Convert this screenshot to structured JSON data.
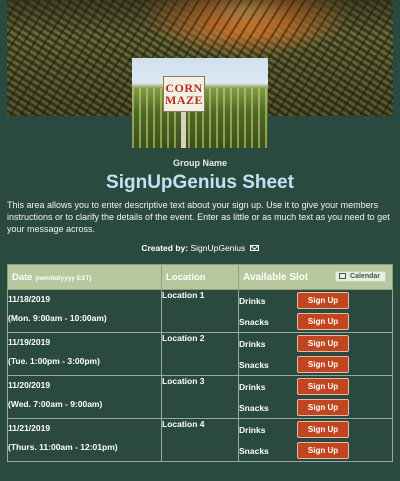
{
  "header": {
    "group_name": "Group Name",
    "title": "SignUpGenius Sheet",
    "description": "This area allows you to enter descriptive text about your sign up. Use it to give your members instructions or to clarify the details of the event. Enter as little or as much text as you need to get your message across.",
    "created_by_label": "Created by:",
    "created_by_name": "SignUpGenius",
    "photo_sign_line1": "CORN",
    "photo_sign_line2": "MAZE"
  },
  "table": {
    "col_date": "Date",
    "col_date_hint": "(mm/dd/yyyy EST)",
    "col_location": "Location",
    "col_slot": "Available Slot",
    "calendar_label": "Calendar",
    "signup_label": "Sign Up",
    "rows": [
      {
        "date": "11/18/2019",
        "time": "(Mon. 9:00am - 10:00am)",
        "location": "Location 1",
        "slots": [
          "Drinks",
          "Snacks"
        ]
      },
      {
        "date": "11/19/2019",
        "time": "(Tue. 1:00pm - 3:00pm)",
        "location": "Location 2",
        "slots": [
          "Drinks",
          "Snacks"
        ]
      },
      {
        "date": "11/20/2019",
        "time": "(Wed. 7:00am - 9:00am)",
        "location": "Location 3",
        "slots": [
          "Drinks",
          "Snacks"
        ]
      },
      {
        "date": "11/21/2019",
        "time": "(Thurs. 11:00am - 12:01pm)",
        "location": "Location 4",
        "slots": [
          "Drinks",
          "Snacks"
        ]
      }
    ]
  }
}
